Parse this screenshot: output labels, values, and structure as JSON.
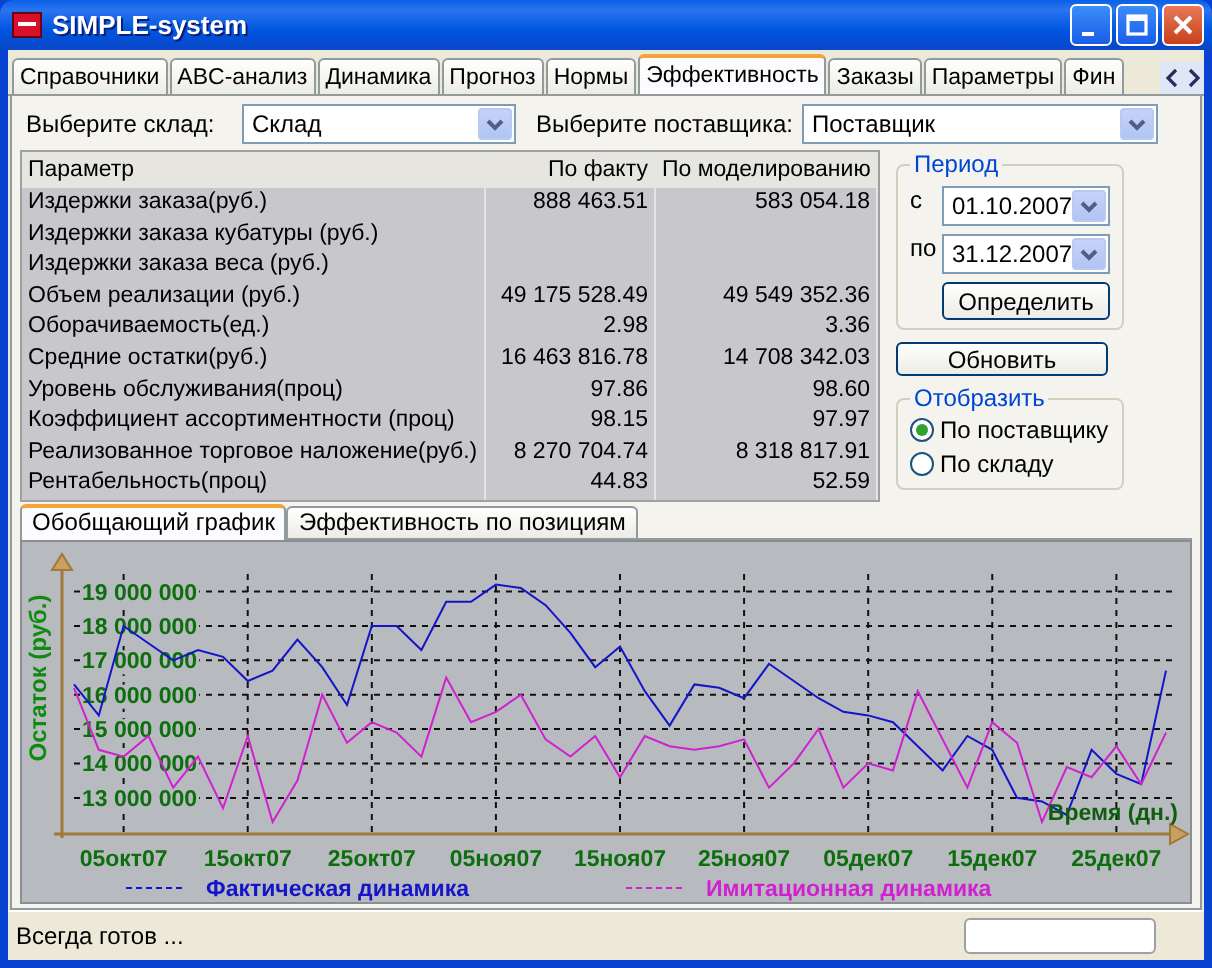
{
  "window": {
    "title": "SIMPLE-system"
  },
  "tabs": [
    {
      "label": "Справочники",
      "selected": false
    },
    {
      "label": "ABC-анализ",
      "selected": false
    },
    {
      "label": "Динамика",
      "selected": false
    },
    {
      "label": "Прогноз",
      "selected": false
    },
    {
      "label": "Нормы",
      "selected": false
    },
    {
      "label": "Эффективность",
      "selected": true
    },
    {
      "label": "Заказы",
      "selected": false
    },
    {
      "label": "Параметры",
      "selected": false
    },
    {
      "label": "Фин",
      "selected": false
    }
  ],
  "filters": [
    {
      "label": "Выберите склад:",
      "value": "Склад"
    },
    {
      "label": "Выберите поставщика:",
      "value": "Поставщик"
    }
  ],
  "table": {
    "columns": [
      "Параметр",
      "По факту",
      "По моделированию"
    ],
    "rows": [
      {
        "parameter": "Издержки заказа(руб.)",
        "fact": "888 463.51",
        "model": "583 054.18"
      },
      {
        "parameter": "Издержки заказа кубатуры (руб.)"
      },
      {
        "parameter": "Издержки заказа веса (руб.)"
      },
      {
        "parameter": "Объем реализации (руб.)",
        "fact": "49 175 528.49",
        "model": "49 549 352.36"
      },
      {
        "parameter": "Оборачиваемость(ед.)",
        "fact": "2.98",
        "model": "3.36"
      },
      {
        "parameter": "Средние остатки(руб.)",
        "fact": "16 463 816.78",
        "model": "14 708 342.03"
      },
      {
        "parameter": "Уровень обслуживания(проц)",
        "fact": "97.86",
        "model": "98.60"
      },
      {
        "parameter": "Коэффициент ассортиментности (проц)",
        "fact": "98.15",
        "model": "97.97"
      },
      {
        "parameter": "Реализованное торговое наложение(руб.)",
        "fact": "8 270 704.74",
        "model": "8 318 817.91"
      },
      {
        "parameter": "Рентабельность(проц)",
        "fact": "44.83",
        "model": "52.59"
      }
    ]
  },
  "period": {
    "title": "Период",
    "from_label": "с",
    "from": "01.10.2007",
    "to_label": "по",
    "to": "31.12.2007",
    "button": "Определить"
  },
  "refresh_button": "Обновить",
  "display": {
    "title": "Отобразить",
    "options": [
      {
        "label": "По поставщику",
        "selected": true
      },
      {
        "label": "По складу",
        "selected": false
      }
    ]
  },
  "bottom_tabs": [
    {
      "label": "Обобщающий график",
      "selected": true
    },
    {
      "label": "Эффективность по позициям",
      "selected": false
    }
  ],
  "chart": {
    "chart_data": {
      "type": "line",
      "xlabel": "Время (дн.)",
      "ylabel": "Остаток (руб.)",
      "categories": [
        null,
        null,
        "05окт07",
        null,
        null,
        null,
        null,
        "15окт07",
        null,
        null,
        null,
        null,
        "25окт07",
        null,
        null,
        null,
        null,
        "05ноя07",
        null,
        null,
        null,
        null,
        "15ноя07",
        null,
        null,
        null,
        null,
        "25ноя07",
        null,
        null,
        null,
        null,
        "05дек07",
        null,
        null,
        null,
        null,
        "15дек07",
        null,
        null,
        null,
        null,
        "25дек07",
        null,
        null
      ],
      "series": [
        {
          "name": "Фактическая динамика",
          "color": "#1414c8",
          "values": [
            16300000,
            15400000,
            18000000,
            17500000,
            17000000,
            17300000,
            17100000,
            16400000,
            16700000,
            17600000,
            16800000,
            15700000,
            18000000,
            18000000,
            17300000,
            18700000,
            18700000,
            19200000,
            19100000,
            18600000,
            17800000,
            16800000,
            17400000,
            16100000,
            15100000,
            16300000,
            16200000,
            15900000,
            16900000,
            16400000,
            15900000,
            15500000,
            15400000,
            15200000,
            14500000,
            13800000,
            14800000,
            14400000,
            13000000,
            12900000,
            12500000,
            14400000,
            13700000,
            13400000,
            16700000
          ]
        },
        {
          "name": "Имитационная динамика",
          "color": "#d020d0",
          "values": [
            16200000,
            14400000,
            14200000,
            14800000,
            13300000,
            14200000,
            12700000,
            14800000,
            12300000,
            13500000,
            16000000,
            14600000,
            15200000,
            14900000,
            14200000,
            16500000,
            15200000,
            15500000,
            16000000,
            14700000,
            14200000,
            14800000,
            13600000,
            14800000,
            14500000,
            14400000,
            14500000,
            14700000,
            13300000,
            14000000,
            15000000,
            13300000,
            14000000,
            13800000,
            16100000,
            14700000,
            13300000,
            15200000,
            14600000,
            12300000,
            13900000,
            13600000,
            14500000,
            13400000,
            14900000
          ]
        }
      ],
      "ylim": [
        11950000,
        19800000
      ],
      "grid": true,
      "legend": true,
      "yticks": [
        {
          "value": 13000000,
          "label": "13 000 000"
        },
        {
          "value": 14000000,
          "label": "14 000 000"
        },
        {
          "value": 15000000,
          "label": "15 000 000"
        },
        {
          "value": 16000000,
          "label": "16 000 000"
        },
        {
          "value": 17000000,
          "label": "17 000 000"
        },
        {
          "value": 18000000,
          "label": "18 000 000"
        },
        {
          "value": 19000000,
          "label": "19 000 000"
        }
      ]
    }
  },
  "status_bar": {
    "text": "Всегда готов ..."
  }
}
